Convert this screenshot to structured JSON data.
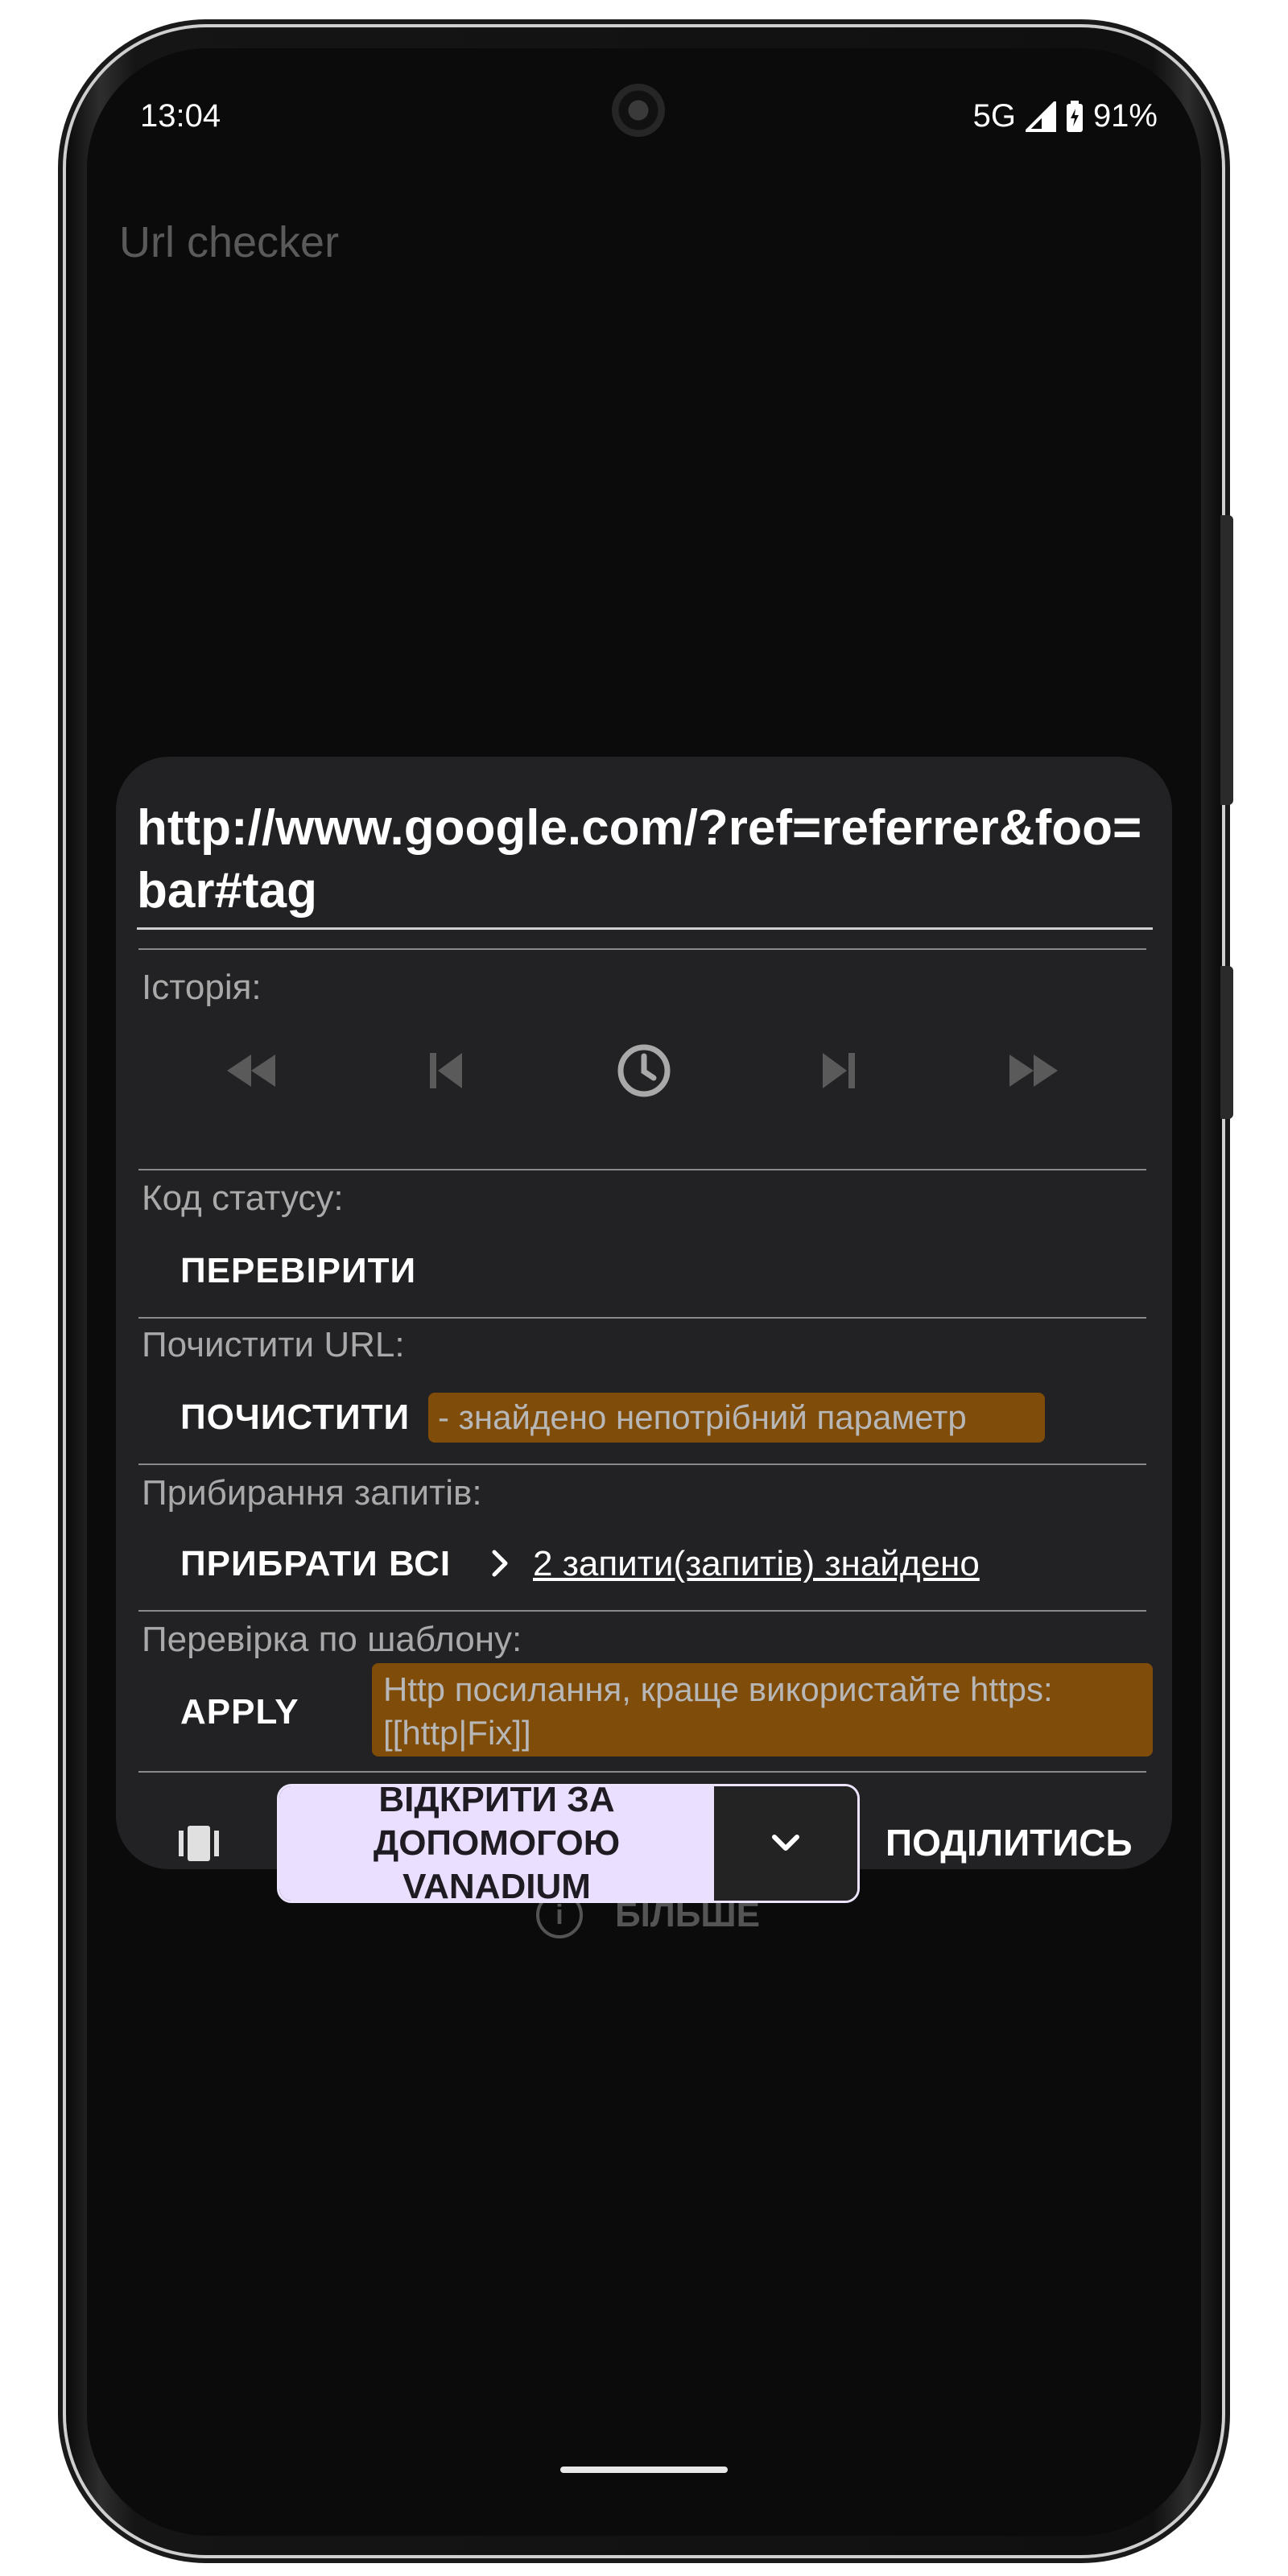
{
  "status_bar": {
    "time": "13:04",
    "network": "5G",
    "battery": "91%"
  },
  "app": {
    "title": "Url checker"
  },
  "dialog": {
    "url": "http://www.google.com/?ref=referrer&foo=bar#tag",
    "history": {
      "label": "Історія:"
    },
    "status_code": {
      "label": "Код статусу:",
      "button": "ПЕРЕВІРИТИ"
    },
    "clear_url": {
      "label": "Почистити URL:",
      "button": "ПОЧИСТИТИ",
      "message": "- знайдено непотрібний параметр"
    },
    "queries": {
      "label": "Прибирання запитів:",
      "button": "ПРИБРАТИ ВСІ",
      "found": "2 запити(запитів) знайдено"
    },
    "pattern": {
      "label": "Перевірка по шаблону:",
      "button": "APPLY",
      "message": "Http посилання, краще використайте https: [[http|Fix]]"
    },
    "bottom": {
      "open_line1": "ВІДКРИТИ ЗА",
      "open_line2": "ДОПОМОГОЮ",
      "open_line3": "VANADIUM",
      "share": "ПОДІЛИТИСЬ"
    }
  },
  "background": {
    "more_label": "БІЛЬШЕ"
  },
  "colors": {
    "warning_bg": "#7f4c0a",
    "primary_button_bg": "#eadfff",
    "dialog_bg": "#222224"
  }
}
